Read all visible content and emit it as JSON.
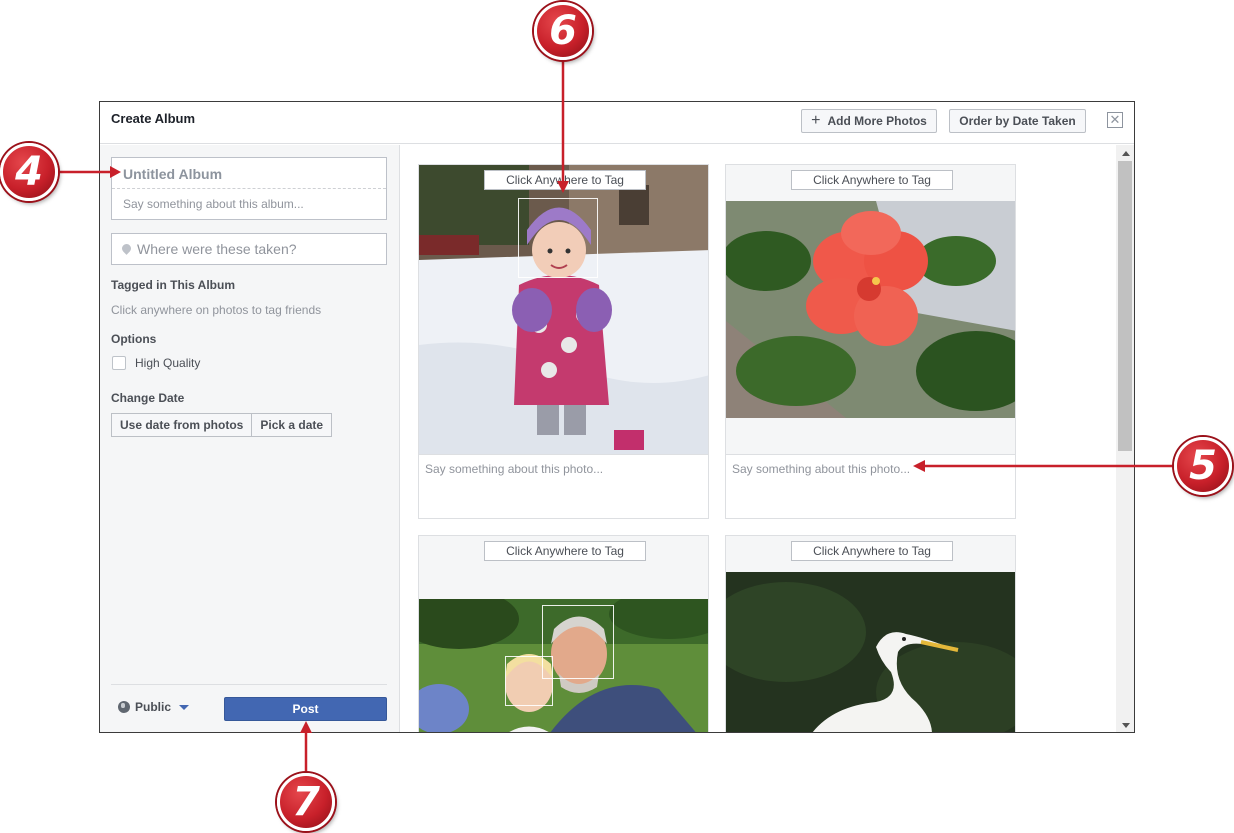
{
  "dialog": {
    "title": "Create Album",
    "add_more_label": "Add More Photos",
    "order_label": "Order by Date Taken",
    "close_glyph": "✕"
  },
  "sidebar": {
    "album_name_placeholder": "Untitled Album",
    "album_desc_placeholder": "Say something about this album...",
    "location_placeholder": "Where were these taken?",
    "tagged_heading": "Tagged in This Album",
    "tagged_hint": "Click anywhere on photos to tag friends",
    "options_heading": "Options",
    "high_quality_label": "High Quality",
    "high_quality_checked": false,
    "change_date_heading": "Change Date",
    "use_date_label": "Use date from photos",
    "pick_date_label": "Pick a date",
    "privacy_label": "Public",
    "post_label": "Post"
  },
  "photos": [
    {
      "tag_label": "Click Anywhere to Tag",
      "caption_placeholder": "Say something about this photo..."
    },
    {
      "tag_label": "Click Anywhere to Tag",
      "caption_placeholder": "Say something about this photo..."
    },
    {
      "tag_label": "Click Anywhere to Tag"
    },
    {
      "tag_label": "Click Anywhere to Tag"
    }
  ],
  "callouts": [
    "4",
    "5",
    "6",
    "7"
  ],
  "colors": {
    "post_button": "#4267b2",
    "callout_red": "#c8202a"
  }
}
